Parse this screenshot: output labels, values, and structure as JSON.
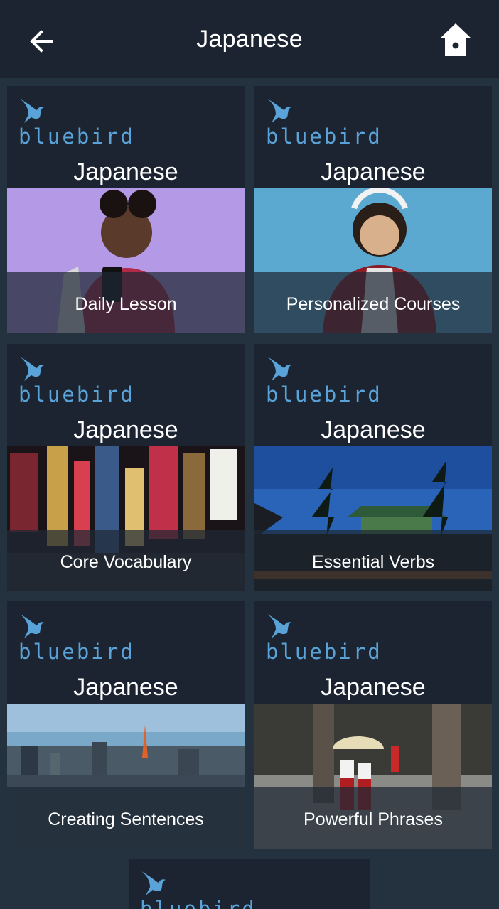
{
  "header": {
    "title": "Japanese",
    "back_icon": "arrow-left-icon",
    "home_icon": "home-icon"
  },
  "colors": {
    "background": "#243240",
    "card": "#1b2430",
    "brand": "#5aa3d8",
    "text": "#ffffff"
  },
  "cards": [
    {
      "brand": "bluebird",
      "language": "Japanese",
      "caption": "Daily Lesson"
    },
    {
      "brand": "bluebird",
      "language": "Japanese",
      "caption": "Personalized Courses"
    },
    {
      "brand": "bluebird",
      "language": "Japanese",
      "caption": "Core Vocabulary"
    },
    {
      "brand": "bluebird",
      "language": "Japanese",
      "caption": "Essential Verbs"
    },
    {
      "brand": "bluebird",
      "language": "Japanese",
      "caption": "Creating Sentences"
    },
    {
      "brand": "bluebird",
      "language": "Japanese",
      "caption": "Powerful Phrases"
    },
    {
      "brand": "bluebird"
    }
  ]
}
